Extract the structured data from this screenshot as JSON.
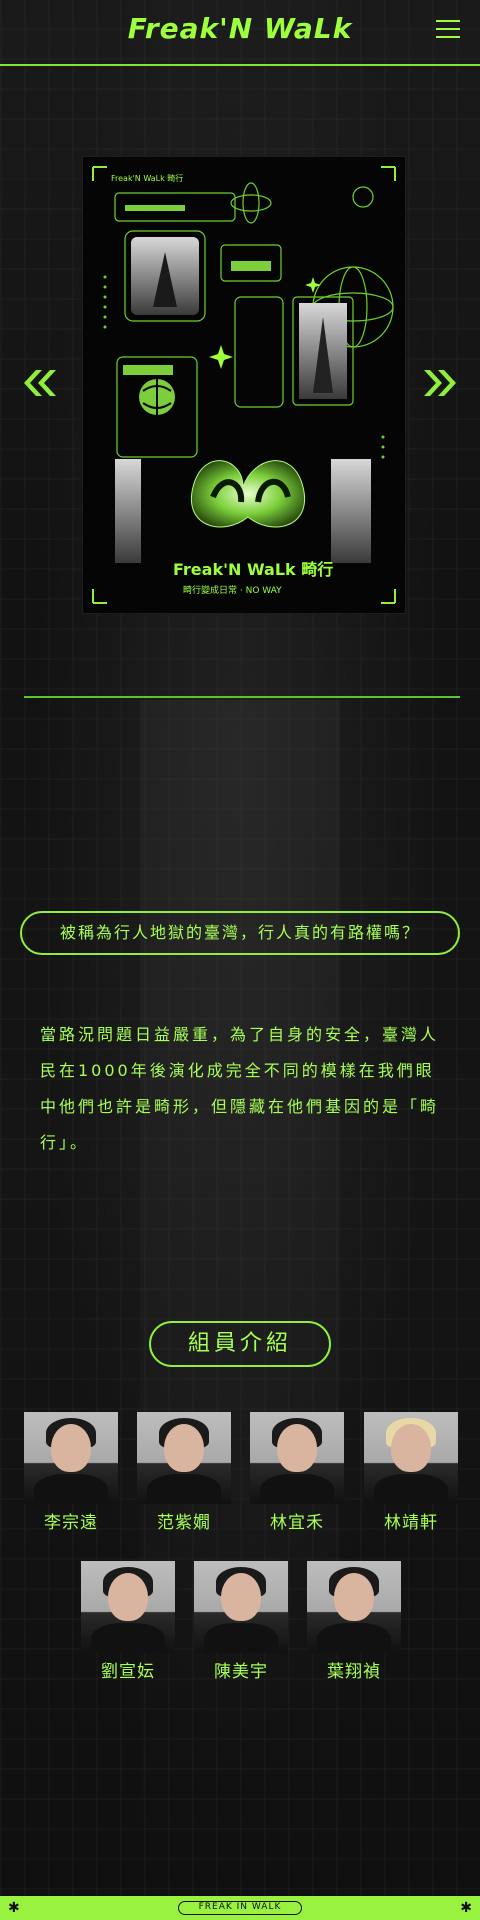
{
  "header": {
    "logo": "Freak'N WaLk",
    "menu_icon": "hamburger-icon"
  },
  "slider": {
    "prev_icon": "double-chevron-left-icon",
    "next_icon": "double-chevron-right-icon",
    "poster": {
      "corner_label": "Freak'N WaLk 畸行",
      "title": "Freak'N WaLk 畸行",
      "subtitle": "畸行變成日常 · NO WAY"
    }
  },
  "question": "被稱為行人地獄的臺灣，行人真的有路權嗎？",
  "description": "當路況問題日益嚴重，為了自身的安全，臺灣人民在1000年後演化成完全不同的模樣在我們眼中他們也許是畸形，但隱藏在他們基因的是「畸行」。",
  "team": {
    "title": "組員介紹",
    "members": [
      "李宗遠",
      "范紫嫺",
      "林宜禾",
      "林靖軒",
      "劉宣妘",
      "陳美宇",
      "葉翔禎"
    ]
  },
  "footer": {
    "label": "FREAK IN WALK"
  },
  "colors": {
    "accent": "#9dff3d",
    "background": "#161616"
  }
}
